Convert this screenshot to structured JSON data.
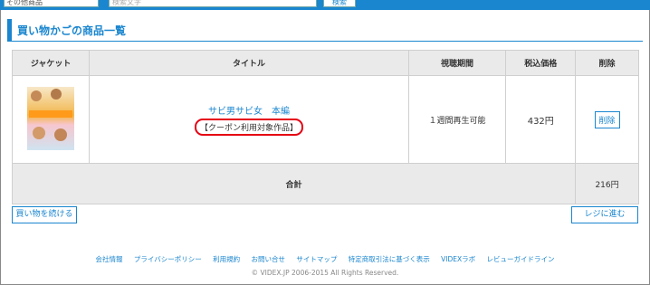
{
  "search": {
    "category_label": "その他商品",
    "input_placeholder": "検索文字",
    "button_label": "検索"
  },
  "page": {
    "heading": "買い物かごの商品一覧"
  },
  "table": {
    "headers": [
      "ジャケット",
      "タイトル",
      "視聴期間",
      "税込価格",
      "削除"
    ],
    "item": {
      "title": "サビ男サビ女　本編",
      "coupon": "【クーポン利用対象作品】",
      "period": "１週間再生可能",
      "price": "432円",
      "delete_label": "削除"
    },
    "total_label": "合計",
    "total_amount": "216円"
  },
  "actions": {
    "continue_label": "買い物を続ける",
    "checkout_label": "レジに進む"
  },
  "footer": {
    "links": [
      "会社情報",
      "プライバシーポリシー",
      "利用規約",
      "お問い合せ",
      "サイトマップ",
      "特定商取引法に基づく表示",
      "VIDEXラボ",
      "レビューガイドライン"
    ],
    "copyright": "© VIDEX.JP 2006-2015 All Rights Reserved."
  },
  "colors": {
    "accent": "#1a86cf",
    "coupon_outline": "#e60012",
    "table_header_bg": "#eaeaea"
  }
}
